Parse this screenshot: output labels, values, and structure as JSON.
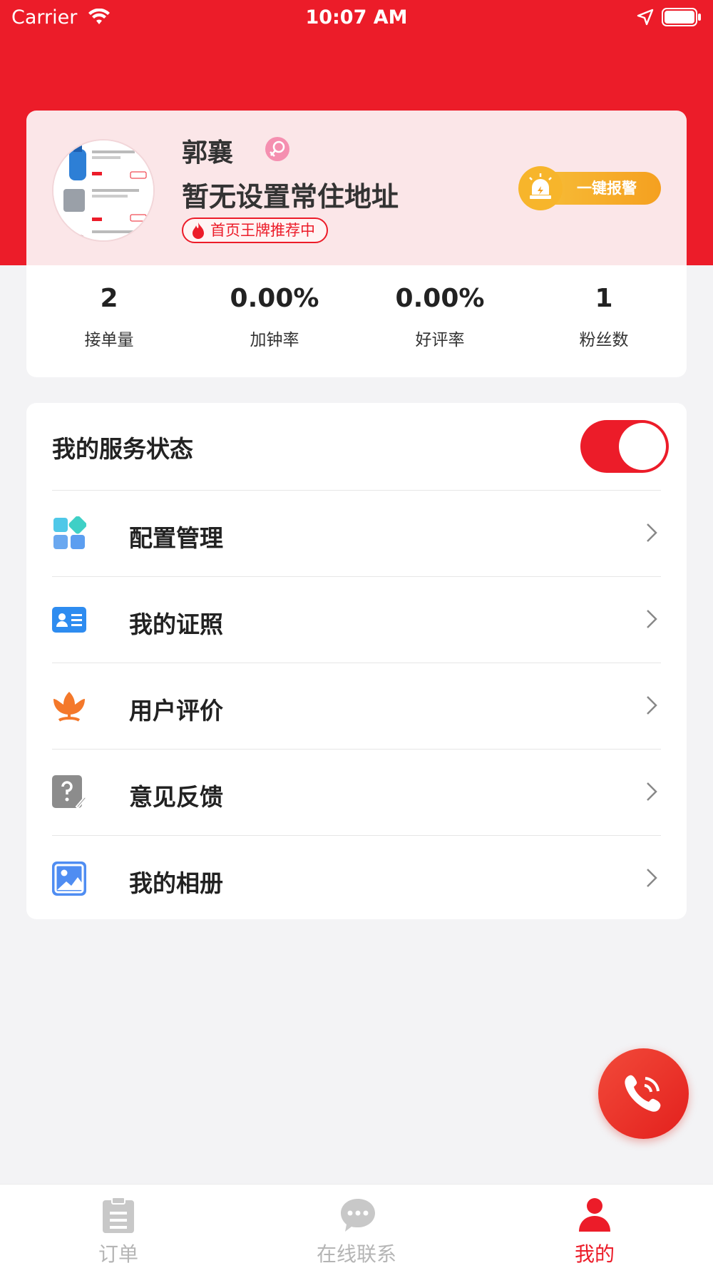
{
  "status_bar": {
    "carrier": "Carrier",
    "time": "10:07 AM"
  },
  "profile": {
    "name": "郭襄",
    "gender_icon": "female-icon",
    "address": "暂无设置常住地址",
    "promo_badge": "首页王牌推荐中",
    "alarm_button": "一键报警"
  },
  "stats": [
    {
      "value": "2",
      "label": "接单量"
    },
    {
      "value": "0.00%",
      "label": "加钟率"
    },
    {
      "value": "0.00%",
      "label": "好评率"
    },
    {
      "value": "1",
      "label": "粉丝数"
    }
  ],
  "service": {
    "label": "我的服务状态",
    "enabled": true
  },
  "menu": [
    {
      "label": "配置管理",
      "icon": "grid-config-icon"
    },
    {
      "label": "我的证照",
      "icon": "id-card-icon"
    },
    {
      "label": "用户评价",
      "icon": "flower-icon"
    },
    {
      "label": "意见反馈",
      "icon": "feedback-icon"
    },
    {
      "label": "我的相册",
      "icon": "photo-album-icon"
    }
  ],
  "tabs": [
    {
      "label": "订单",
      "icon": "clipboard-icon",
      "active": false
    },
    {
      "label": "在线联系",
      "icon": "chat-bubble-icon",
      "active": false
    },
    {
      "label": "我的",
      "icon": "person-icon",
      "active": true
    }
  ],
  "colors": {
    "brand_red": "#ec1c29",
    "alarm_orange": "#f5a020",
    "tab_inactive": "#b5b5b5"
  }
}
